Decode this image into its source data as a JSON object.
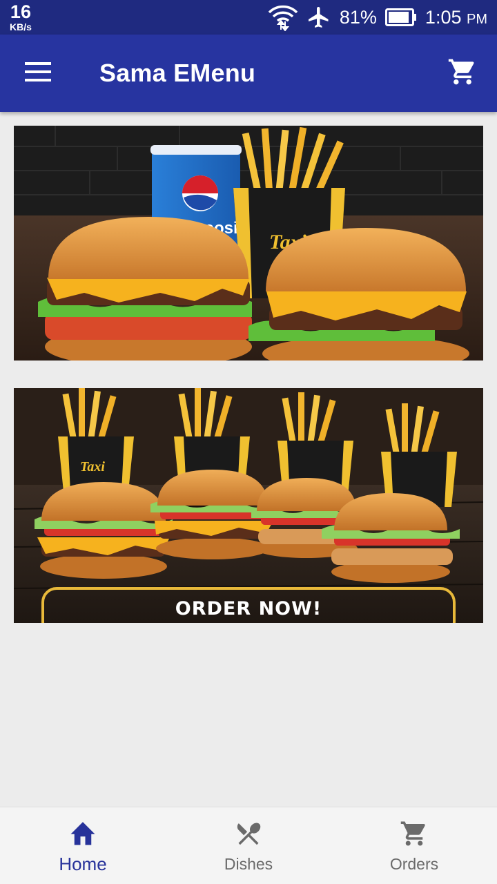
{
  "status": {
    "speed_value": "16",
    "speed_unit": "KB/s",
    "battery": "81%",
    "time": "1:05",
    "ampm": "PM"
  },
  "app_bar": {
    "title": "Sama EMenu",
    "menu_icon": "hamburger-menu-icon",
    "cart_icon": "shopping-cart-icon"
  },
  "banners": [
    {
      "image": "burgers-fries-pepsi-banner",
      "brand_text": "peosi",
      "box_text": "Taxi"
    },
    {
      "image": "four-burgers-fries-banner",
      "cta": "ORDER NOW!",
      "box_text": "Taxi"
    }
  ],
  "bottom_nav": [
    {
      "label": "Home",
      "icon": "home-icon",
      "active": true
    },
    {
      "label": "Dishes",
      "icon": "fork-spoon-icon",
      "active": false
    },
    {
      "label": "Orders",
      "icon": "shopping-cart-icon",
      "active": false
    }
  ],
  "colors": {
    "status_bar": "#1f2a80",
    "app_bar": "#2734a0",
    "accent": "#27329a",
    "background": "#ececec"
  }
}
